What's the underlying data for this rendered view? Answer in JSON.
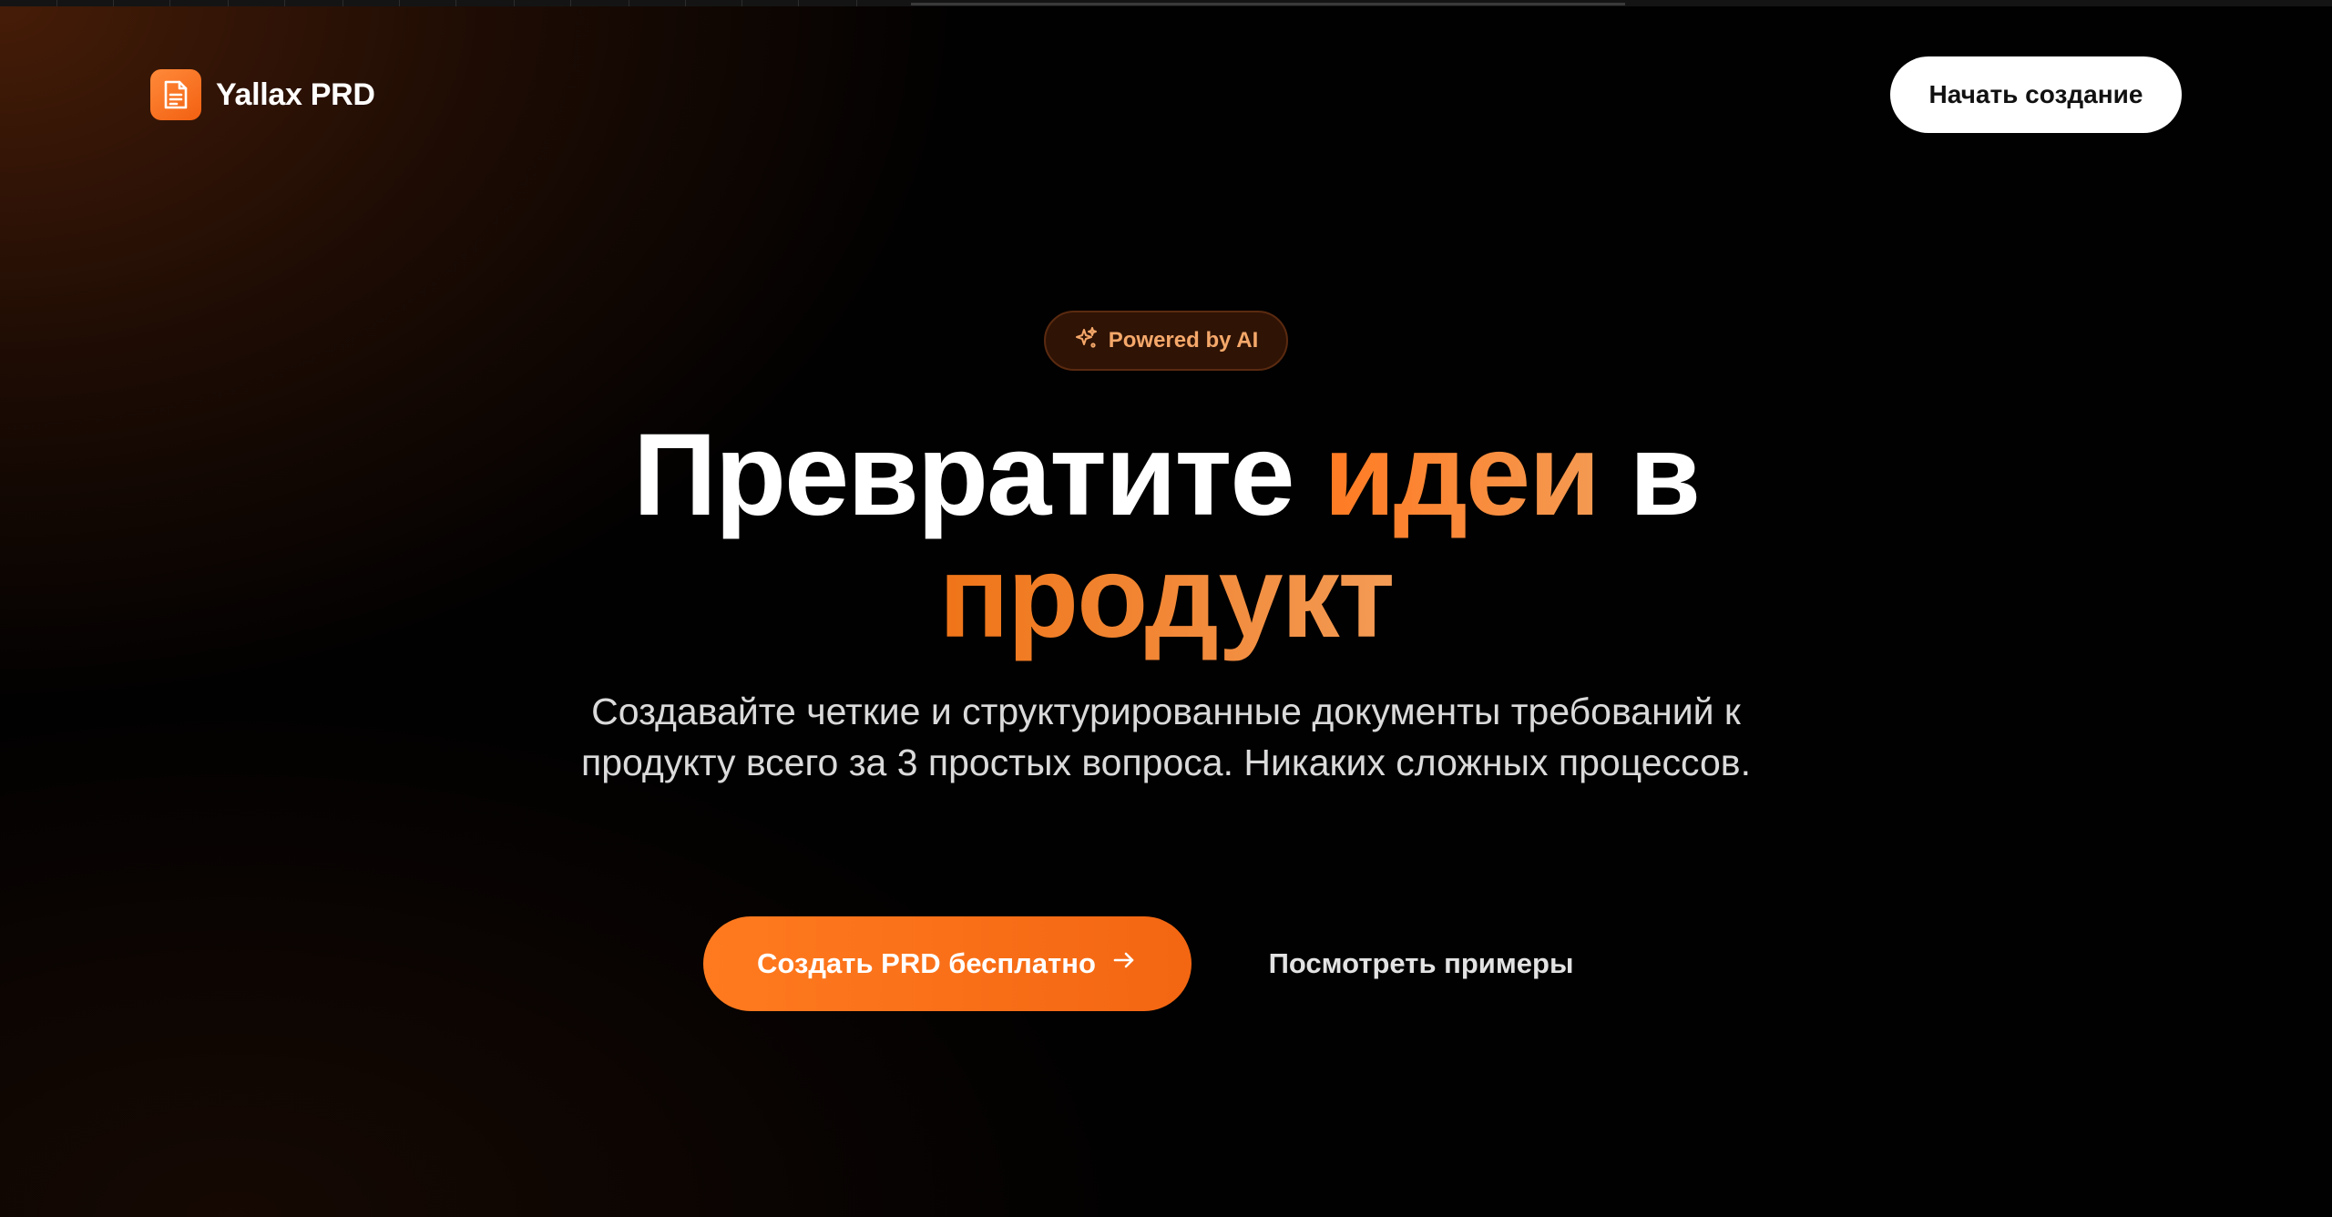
{
  "brand": {
    "logo_icon": "document-icon",
    "name": "Yallax PRD",
    "accent_color": "#F26A1B"
  },
  "nav": {
    "cta_label": "Начать создание"
  },
  "hero": {
    "badge": {
      "icon": "sparkles-icon",
      "label": "Powered by AI"
    },
    "headline": {
      "part1": "Превратите ",
      "accent1": "идеи",
      "part2": " в",
      "accent2": "продукт"
    },
    "subtitle": "Создавайте четкие и структурированные документы требований к продукту всего за 3 простых вопроса. Никаких сложных процессов.",
    "primary_cta": {
      "label": "Создать PRD бесплатно",
      "icon": "arrow-right-icon"
    },
    "secondary_cta": {
      "label": "Посмотреть примеры"
    }
  }
}
